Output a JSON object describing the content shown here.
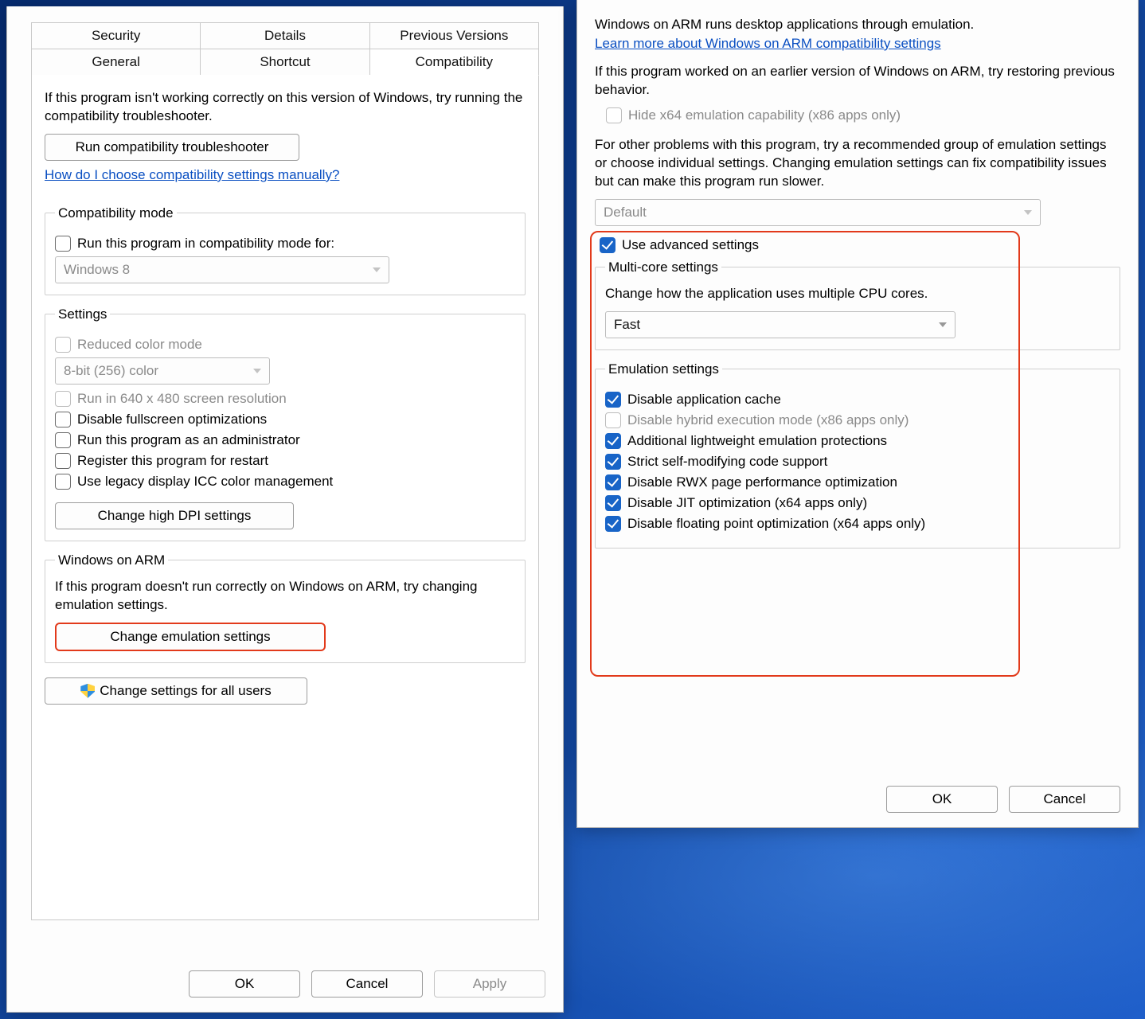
{
  "left": {
    "tabs_row1": [
      "Security",
      "Details",
      "Previous Versions"
    ],
    "tabs_row2": [
      "General",
      "Shortcut",
      "Compatibility"
    ],
    "intro": "If this program isn't working correctly on this version of Windows, try running the compatibility troubleshooter.",
    "run_troubleshooter": "Run compatibility troubleshooter",
    "how_link": "How do I choose compatibility settings manually?",
    "compat_mode": {
      "legend": "Compatibility mode",
      "check_label": "Run this program in compatibility mode for:",
      "select_value": "Windows 8"
    },
    "settings": {
      "legend": "Settings",
      "reduced_color": "Reduced color mode",
      "color_select": "8-bit (256) color",
      "run_640": "Run in 640 x 480 screen resolution",
      "disable_fs": "Disable fullscreen optimizations",
      "run_admin": "Run this program as an administrator",
      "register_restart": "Register this program for restart",
      "legacy_icc": "Use legacy display ICC color management",
      "high_dpi_btn": "Change high DPI settings"
    },
    "arm": {
      "legend": "Windows on ARM",
      "desc": "If this program doesn't run correctly on Windows on ARM, try changing emulation settings.",
      "btn": "Change emulation settings"
    },
    "all_users_btn": "Change settings for all users",
    "footer": {
      "ok": "OK",
      "cancel": "Cancel",
      "apply": "Apply"
    }
  },
  "right": {
    "para1": "Windows on ARM runs desktop applications through emulation.",
    "learn_link": "Learn more about Windows on ARM compatibility settings",
    "para2": "If this program worked on an earlier version of Windows on ARM, try restoring previous behavior.",
    "hide_x64": "Hide x64 emulation capability (x86 apps only)",
    "para3": "For other problems with this program, try a recommended group of emulation settings or choose individual settings.  Changing emulation settings can fix compatibility issues but can make this program run slower.",
    "preset_select": "Default",
    "use_advanced": "Use advanced settings",
    "multicore": {
      "legend": "Multi-core settings",
      "desc": "Change how the application uses multiple CPU cores.",
      "value": "Fast"
    },
    "emu": {
      "legend": "Emulation settings",
      "items": [
        {
          "label": "Disable application cache",
          "checked": true,
          "disabled": false
        },
        {
          "label": "Disable hybrid execution mode (x86 apps only)",
          "checked": false,
          "disabled": true
        },
        {
          "label": "Additional lightweight emulation protections",
          "checked": true,
          "disabled": false
        },
        {
          "label": "Strict self-modifying code support",
          "checked": true,
          "disabled": false
        },
        {
          "label": "Disable RWX page performance optimization",
          "checked": true,
          "disabled": false
        },
        {
          "label": "Disable JIT optimization (x64 apps only)",
          "checked": true,
          "disabled": false
        },
        {
          "label": "Disable floating point optimization (x64 apps only)",
          "checked": true,
          "disabled": false
        }
      ]
    },
    "footer": {
      "ok": "OK",
      "cancel": "Cancel"
    }
  }
}
